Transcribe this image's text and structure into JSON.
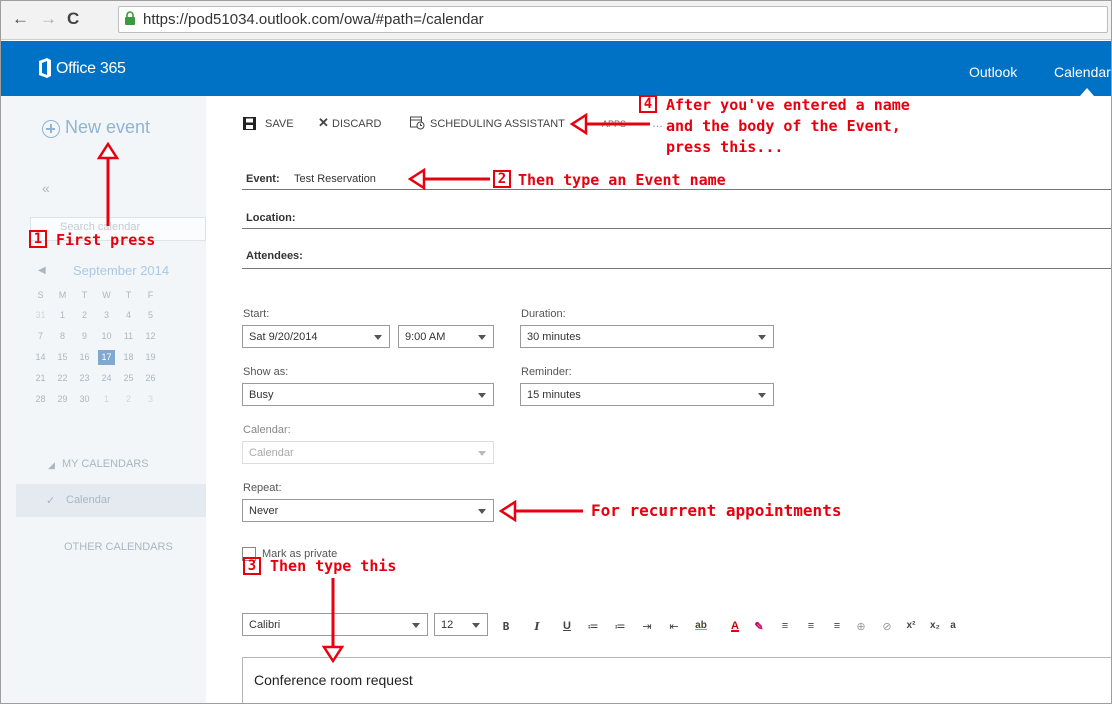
{
  "browser": {
    "url": "https://pod51034.outlook.com/owa/#path=/calendar",
    "back_glyph": "←",
    "forward_glyph": "→",
    "reload_glyph": "C"
  },
  "header": {
    "brand": "Office 365",
    "nav": [
      "Outlook",
      "Calendar"
    ],
    "accent": "#0072c6"
  },
  "sidebar": {
    "new_event": "New event",
    "collapse": "«",
    "search_placeholder": "Search calendar",
    "month": "September 2014",
    "weekdays": [
      "S",
      "M",
      "T",
      "W",
      "T",
      "F"
    ],
    "weeks": [
      [
        "31",
        "1",
        "2",
        "3",
        "4",
        "5"
      ],
      [
        "7",
        "8",
        "9",
        "10",
        "11",
        "12"
      ],
      [
        "14",
        "15",
        "16",
        "17",
        "18",
        "19"
      ],
      [
        "21",
        "22",
        "23",
        "24",
        "25",
        "26"
      ],
      [
        "28",
        "29",
        "30",
        "1",
        "2",
        "3"
      ]
    ],
    "today": "17",
    "my_calendars": "MY CALENDARS",
    "calendar_item": "Calendar",
    "other_calendars": "OTHER CALENDARS"
  },
  "toolbar": {
    "save": "SAVE",
    "discard": "DISCARD",
    "scheduling": "SCHEDULING ASSISTANT",
    "apps": "APPS"
  },
  "form": {
    "event_label": "Event:",
    "event_value": "Test Reservation",
    "location_label": "Location:",
    "attendees_label": "Attendees:",
    "start_label": "Start:",
    "start_date": "Sat 9/20/2014",
    "start_time": "9:00 AM",
    "duration_label": "Duration:",
    "duration_value": "30 minutes",
    "show_as_label": "Show as:",
    "show_as_value": "Busy",
    "reminder_label": "Reminder:",
    "reminder_value": "15 minutes",
    "calendar_label": "Calendar:",
    "calendar_value": "Calendar",
    "repeat_label": "Repeat:",
    "repeat_value": "Never",
    "private_label": "Mark as private"
  },
  "editor": {
    "font": "Calibri",
    "size": "12",
    "buttons": [
      "B",
      "I",
      "U",
      "≔",
      "≔",
      "⇥",
      "⇤",
      "ab",
      "A",
      "✎",
      "≡",
      "≡",
      "≡",
      "⊕",
      "⊘",
      "x²",
      "x₂",
      "a"
    ],
    "body_text": "Conference room request"
  },
  "annotations": {
    "step1_num": "1",
    "step1_text": "First press",
    "step2_num": "2",
    "step2_text": "Then type an Event name",
    "step3_num": "3",
    "step3_text": "Then type this",
    "step4_num": "4",
    "step4_line1": "After you've entered a name",
    "step4_line2": "and the body of the Event,",
    "step4_line3": "press this...",
    "repeat_note": "For recurrent appointments",
    "color": "#e8000f"
  }
}
